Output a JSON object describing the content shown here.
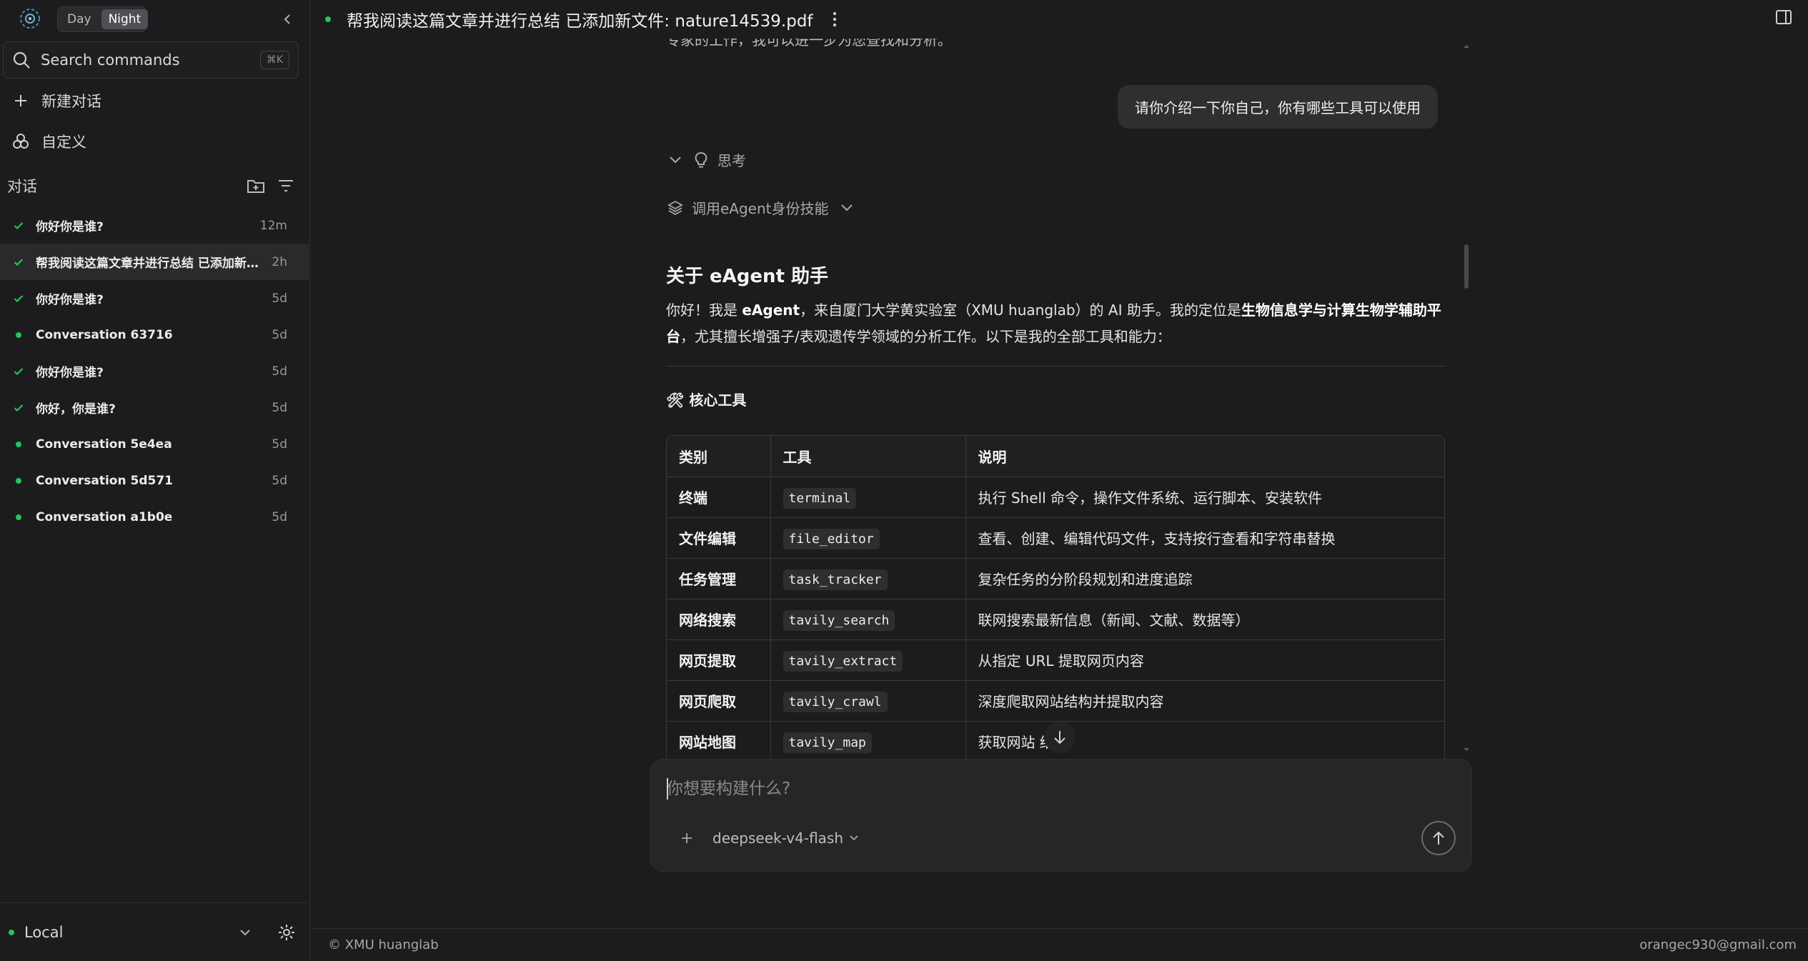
{
  "sidebar": {
    "theme": {
      "day_label": "Day",
      "night_label": "Night",
      "active": "Night"
    },
    "search": {
      "label": "Search commands",
      "shortcut": "⌘K"
    },
    "new_chat_label": "新建对话",
    "customize_label": "自定义",
    "conversations_title": "对话",
    "conversations": [
      {
        "title": "你好你是谁?",
        "time": "12m",
        "status": "done",
        "active": false
      },
      {
        "title": "帮我阅读这篇文章并进行总结 已添加新文件: nature14539.pdf",
        "time": "2h",
        "status": "done",
        "active": true
      },
      {
        "title": "你好你是谁?",
        "time": "5d",
        "status": "done",
        "active": false
      },
      {
        "title": "Conversation 63716",
        "time": "5d",
        "status": "dot",
        "active": false
      },
      {
        "title": "你好你是谁?",
        "time": "5d",
        "status": "done",
        "active": false
      },
      {
        "title": "你好，你是谁?",
        "time": "5d",
        "status": "done",
        "active": false
      },
      {
        "title": "Conversation 5e4ea",
        "time": "5d",
        "status": "dot",
        "active": false
      },
      {
        "title": "Conversation 5d571",
        "time": "5d",
        "status": "dot",
        "active": false
      },
      {
        "title": "Conversation a1b0e",
        "time": "5d",
        "status": "dot",
        "active": false
      }
    ],
    "workspace_label": "Local"
  },
  "header": {
    "title": "帮我阅读这篇文章并进行总结 已添加新文件: nature14539.pdf"
  },
  "chat": {
    "cut_text": "专家的工作，我可以进一步为您查找和分析。",
    "user_message": "请你介绍一下你自己，你有哪些工具可以使用",
    "thinking_label": "思考",
    "skill_label": "调用eAgent身份技能",
    "answer_heading": "关于 eAgent 助手",
    "intro": {
      "p1": "你好！我是 ",
      "name": "eAgent",
      "p2": "，来自厦门大学黄实验室（XMU huanglab）的 AI 助手。我的定位是",
      "role": "生物信息学与计算生物学辅助平台",
      "p3": "，尤其擅长增强子/表观遗传学领域的分析工作。以下是我的全部工具和能力："
    },
    "tools_heading": "🛠 核心工具",
    "table": {
      "headers": [
        "类别",
        "工具",
        "说明"
      ],
      "rows": [
        {
          "category": "终端",
          "tool": "terminal",
          "desc": "执行 Shell 命令，操作文件系统、运行脚本、安装软件"
        },
        {
          "category": "文件编辑",
          "tool": "file_editor",
          "desc": "查看、创建、编辑代码文件，支持按行查看和字符串替换"
        },
        {
          "category": "任务管理",
          "tool": "task_tracker",
          "desc": "复杂任务的分阶段规划和进度追踪"
        },
        {
          "category": "网络搜索",
          "tool": "tavily_search",
          "desc": "联网搜索最新信息（新闻、文献、数据等）"
        },
        {
          "category": "网页提取",
          "tool": "tavily_extract",
          "desc": "从指定 URL 提取网页内容"
        },
        {
          "category": "网页爬取",
          "tool": "tavily_crawl",
          "desc": "深度爬取网站结构并提取内容"
        },
        {
          "category": "网站地图",
          "tool": "tavily_map",
          "desc": "获取网站 结构"
        }
      ]
    }
  },
  "composer": {
    "placeholder": "你想要构建什么?",
    "model": "deepseek-v4-flash"
  },
  "footer": {
    "copyright": "© XMU huanglab",
    "email": "orangec930@gmail.com"
  },
  "colors": {
    "accent_green": "#22c55e",
    "background": "#1c1c1e"
  }
}
